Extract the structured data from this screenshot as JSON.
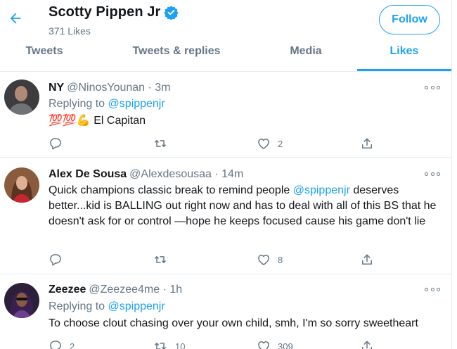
{
  "header": {
    "title": "Scotty Pippen Jr",
    "subtitle": "371 Likes",
    "follow_label": "Follow"
  },
  "tabs": [
    {
      "label": "Tweets",
      "active": false
    },
    {
      "label": "Tweets & replies",
      "active": false
    },
    {
      "label": "Media",
      "active": false
    },
    {
      "label": "Likes",
      "active": true
    }
  ],
  "colors": {
    "accent": "#1da1f2",
    "muted": "#657786",
    "text": "#14171a",
    "divider": "#e6ecf0"
  },
  "tweets": [
    {
      "name": "NY",
      "handle": "@NinosYounan",
      "time": "· 3m",
      "reply_prefix": "Replying to",
      "reply_to": "@spippenjr",
      "emoji": "💯💯💪",
      "text": "El Capitan",
      "reply_count": "",
      "retweet_count": "",
      "like_count": "2"
    },
    {
      "name": "Alex De Sousa",
      "handle": "@Alexdesousaa",
      "time": "· 14m",
      "text_before": "Quick champions classic break to remind people ",
      "mention": "@spippenjr",
      "text_after": " deserves better...kid is BALLING out right now and has to deal with all of this BS that he doesn't ask for or control —hope he keeps focused cause his game don't lie",
      "reply_count": "",
      "retweet_count": "",
      "like_count": "8"
    },
    {
      "name": "Zeezee",
      "handle": "@Zeezee4me",
      "time": "· 1h",
      "reply_prefix": "Replying to",
      "reply_to": "@spippenjr",
      "text": "To choose clout chasing over your own child, smh, I'm so sorry sweetheart",
      "reply_count": "2",
      "retweet_count": "10",
      "like_count": "309"
    }
  ],
  "icons": [
    "back-arrow-icon",
    "verified-badge-icon",
    "more-icon",
    "reply-icon",
    "retweet-icon",
    "like-icon",
    "share-icon"
  ]
}
